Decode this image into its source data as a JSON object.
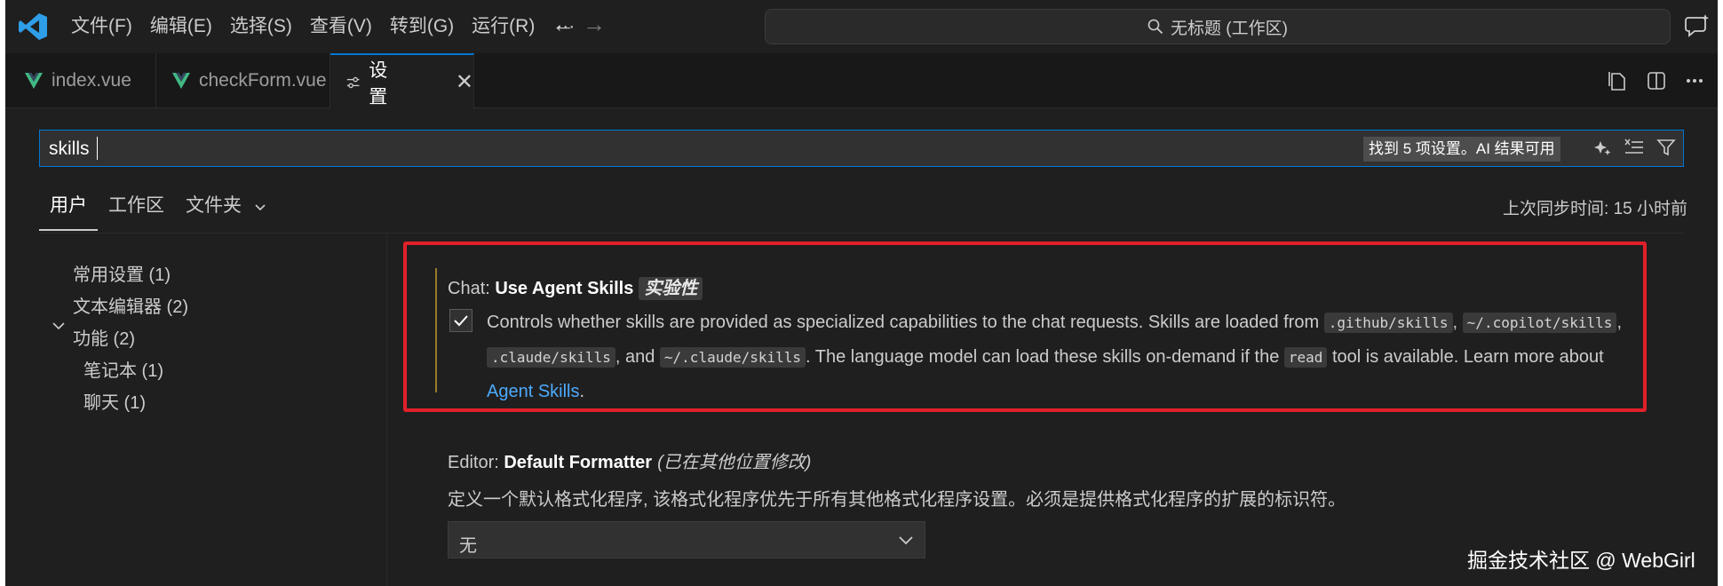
{
  "menu": [
    "文件(F)",
    "编辑(E)",
    "选择(S)",
    "查看(V)",
    "转到(G)",
    "运行(R)"
  ],
  "menu_more": "···",
  "nav": {
    "back": "←",
    "forward": "→"
  },
  "command_center": "无标题 (工作区)",
  "tabs": [
    {
      "label": "index.vue",
      "icon": "vue-icon"
    },
    {
      "label": "checkForm.vue",
      "icon": "vue-icon"
    },
    {
      "label": "设置",
      "icon": "settings-icon",
      "active": true
    }
  ],
  "tab_close": "✕",
  "search": {
    "value": "skills",
    "result_badge": "找到 5 项设置。AI 结果可用"
  },
  "scope_tabs": [
    "用户",
    "工作区",
    "文件夹"
  ],
  "last_sync": "上次同步时间: 15 小时前",
  "toc": [
    {
      "label": "常用设置 (1)"
    },
    {
      "label": "文本编辑器 (2)"
    },
    {
      "label": "功能 (2)",
      "expanded": true
    },
    {
      "label": "笔记本 (1)"
    },
    {
      "label": "聊天 (1)"
    }
  ],
  "setting1": {
    "category": "Chat: ",
    "name": "Use Agent Skills",
    "tag": "实验性",
    "checked": true,
    "desc_1": "Controls whether skills are provided as specialized capabilities to the chat requests. Skills are loaded from ",
    "code_1": ".github/skills",
    "sep_1": ",",
    "code_2": "~/.copilot/skills",
    "sep_2": ",",
    "code_3": ".claude/skills",
    "sep_3": ", and",
    "code_4": "~/.claude/skills",
    "desc_2": ". The language model can load these skills on-demand if the ",
    "code_5": "read",
    "desc_3": " tool is available. Learn more about ",
    "link": "Agent Skills",
    "desc_4": "."
  },
  "setting2": {
    "category": "Editor: ",
    "name": "Default Formatter",
    "modified": "(已在其他位置修改)",
    "desc": "定义一个默认格式化程序, 该格式化程序优先于所有其他格式化程序设置。必须是提供格式化程序的扩展的标识符。",
    "value": "无"
  },
  "watermark": "掘金技术社区 @ WebGirl",
  "colors": {
    "accent": "#0078d4",
    "highlight": "#e0202a",
    "link": "#4daafc",
    "vue_green": "#41b883"
  }
}
